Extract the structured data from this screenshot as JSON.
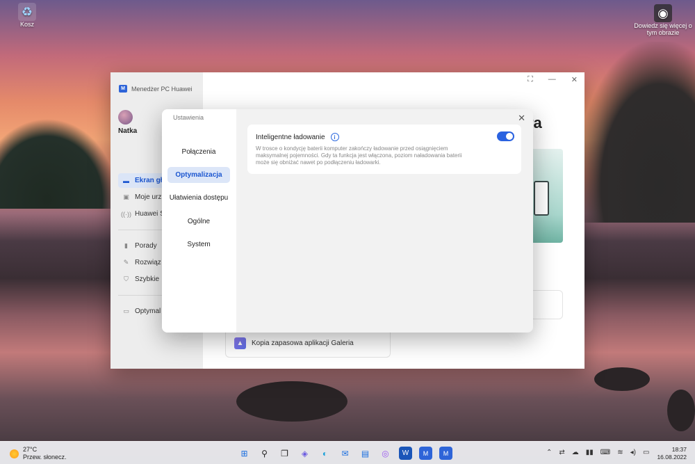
{
  "desktop": {
    "recycle_bin_label": "Kosz",
    "camera_widget_label": "Dowiedz się więcej o tym obrazie"
  },
  "app": {
    "title": "Menedżer PC Huawei",
    "user_name": "Natka",
    "sidebar_items": [
      {
        "label": "Ekran gł",
        "icon": "monitor-icon"
      },
      {
        "label": "Moje urz",
        "icon": "devices-icon"
      },
      {
        "label": "Huawei S",
        "icon": "signal-icon"
      },
      {
        "label": "Porady",
        "icon": "tips-icon"
      },
      {
        "label": "Rozwiąz",
        "icon": "wrench-icon"
      },
      {
        "label": "Szybkie",
        "icon": "shield-icon"
      },
      {
        "label": "Optymal",
        "icon": "optimize-icon"
      }
    ],
    "heading_fragment": "ra",
    "gallery_backup_label": "Kopia zapasowa aplikacji Galeria"
  },
  "settings_dialog": {
    "title": "Ustawienia",
    "nav": [
      "Połączenia",
      "Optymalizacja",
      "Ułatwienia dostępu",
      "Ogólne",
      "System"
    ],
    "active_nav": "Optymalizacja",
    "smart_charging": {
      "title": "Inteligentne ładowanie",
      "description": "W trosce o kondycję baterii komputer zakończy ładowanie przed osiągnięciem maksymalnej pojemności. Gdy ta funkcja jest włączona, poziom naładowania baterii może się obniżać nawet po podłączeniu ładowarki.",
      "enabled": true
    }
  },
  "taskbar": {
    "temperature": "27°C",
    "weather": "Przew. słonecz.",
    "time": "18:37",
    "date": "16.08.2022"
  },
  "colors": {
    "accent": "#2a62e0",
    "active_nav_bg": "#dce6f8"
  }
}
